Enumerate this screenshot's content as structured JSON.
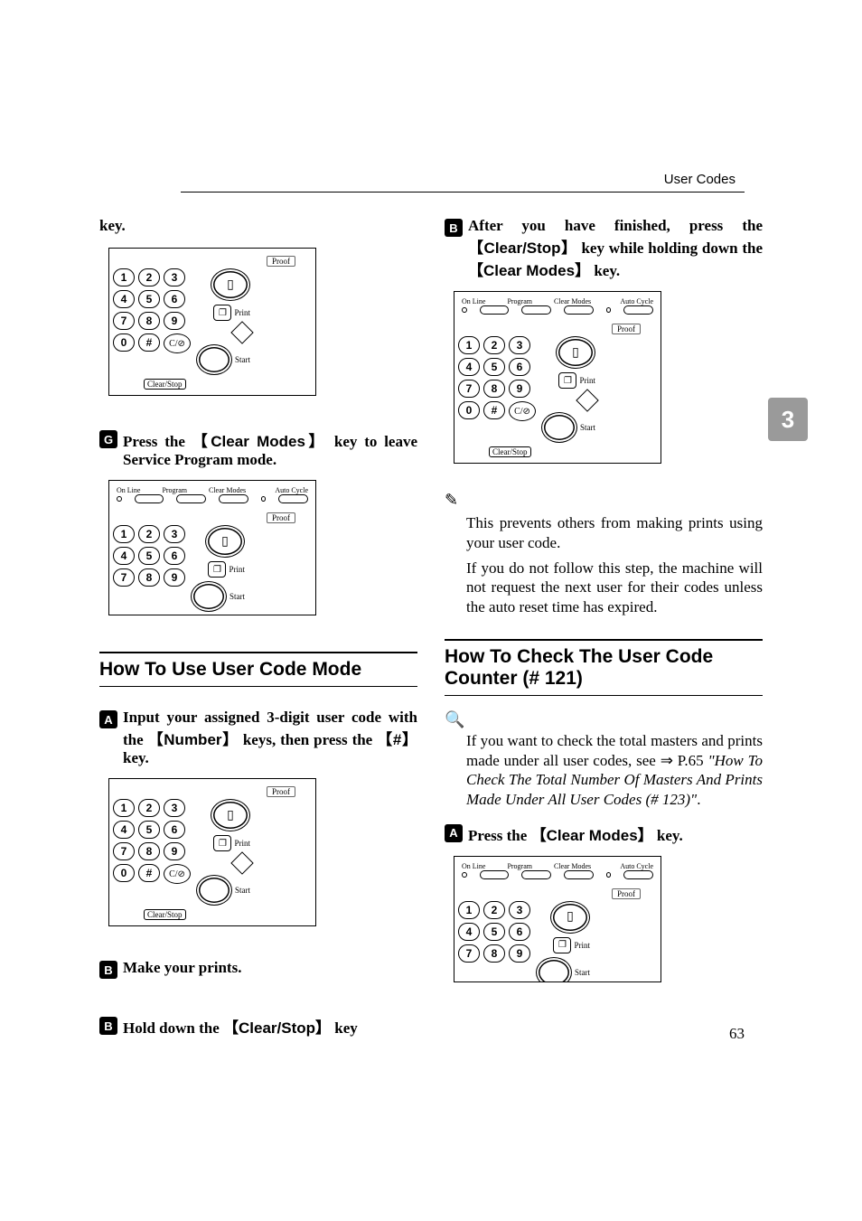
{
  "header": {
    "title": "User Codes"
  },
  "sideTab": "3",
  "pageNumber": "63",
  "left": {
    "keyContinuation": "key.",
    "keypad1": {
      "proof": "Proof",
      "print": "Print",
      "start": "Start",
      "clearstop": "Clear/Stop",
      "cstop": "C/⊘",
      "docIcon": "❐",
      "proofIcon": "▯"
    },
    "stepG": {
      "num": "G",
      "prefix": "Press the ",
      "key": "Clear Modes",
      "suffix": " key to leave Service Program mode."
    },
    "keypad2": {
      "topLabels": [
        "On Line",
        "Program",
        "Clear Modes",
        "Auto Cycle"
      ],
      "proof": "Proof",
      "print": "Print",
      "start": "Start"
    },
    "heading1": "How To Use User Code Mode",
    "stepA": {
      "num": "A",
      "t1": "Input your assigned 3-digit user code with the ",
      "key1": "Number",
      "t2": " keys, then press the ",
      "key2": "#",
      "t3": " key."
    },
    "keypad3": {
      "proof": "Proof",
      "print": "Print",
      "start": "Start",
      "clearstop": "Clear/Stop",
      "cstop": "C/⊘"
    },
    "stepB": {
      "num": "B",
      "text": "Make your prints."
    },
    "stepBalt": {
      "num": "B",
      "t1": "Hold down the ",
      "key": "Clear/Stop",
      "t2": " key"
    }
  },
  "right": {
    "stepB": {
      "num": "B",
      "t1": "After you have finished, press the ",
      "key1": "Clear/Stop",
      "t2": " key while holding down the ",
      "key2": "Clear Modes",
      "t3": " key."
    },
    "keypad4": {
      "topLabels": [
        "On Line",
        "Program",
        "Clear Modes",
        "Auto Cycle"
      ],
      "proof": "Proof",
      "print": "Print",
      "start": "Start",
      "clearstop": "Clear/Stop",
      "cstop": "C/⊘"
    },
    "note": {
      "p1": "This prevents others from making prints using your user code.",
      "p2": "If you do not follow this step, the machine will not request the next user for their codes unless the auto reset time has expired."
    },
    "heading2": "How To Check The User Code Counter (# 121)",
    "prep": {
      "t1": "If you want to check the total masters and prints made under all user codes, see ",
      "ref": "⇒ P.65 ",
      "italic": "\"How To Check The Total Number Of Masters And Prints Made Under All User Codes (# 123)\"",
      "period": "."
    },
    "stepA": {
      "num": "A",
      "t1": "Press the ",
      "key": "Clear Modes",
      "t2": " key."
    },
    "keypad5": {
      "topLabels": [
        "On Line",
        "Program",
        "Clear Modes",
        "Auto Cycle"
      ],
      "proof": "Proof",
      "print": "Print",
      "start": "Start"
    }
  },
  "keypadDigits": [
    "1",
    "2",
    "3",
    "4",
    "5",
    "6",
    "7",
    "8",
    "9",
    "0",
    "#"
  ]
}
